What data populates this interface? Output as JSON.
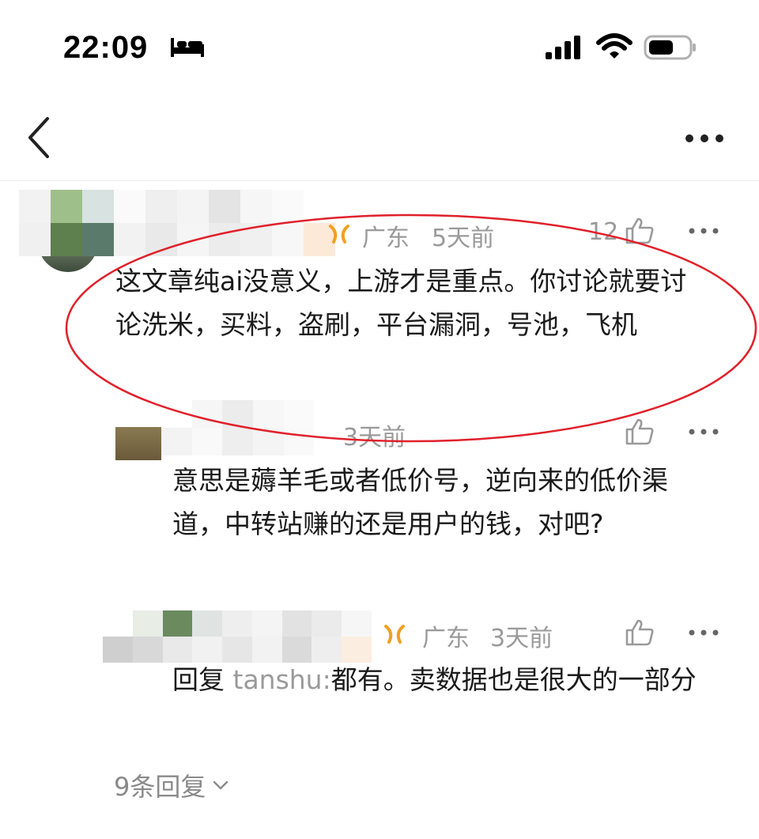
{
  "status_bar": {
    "time": "22:09"
  },
  "comments": {
    "main": {
      "location": "广东",
      "time_ago": "5天前",
      "likes": "12",
      "text": "这文章纯ai没意义，上游才是重点。你讨论就要讨论洗米，买料，盗刷，平台漏洞，号池，飞机"
    },
    "reply1": {
      "time_ago": "3天前",
      "text": "意思是薅羊毛或者低价号，逆向来的低价渠道，中转站赚的还是用户的钱，对吧?"
    },
    "reply2": {
      "location": "广东",
      "time_ago": "3天前",
      "reply_prefix": "回复",
      "reply_to": "tanshu",
      "reply_sep": ":",
      "text": "都有。卖数据也是很大的一部分"
    },
    "more_replies_label": "9条回复"
  },
  "colors": {
    "annotation_ellipse": "#e0202a",
    "meta_gray": "#9a9a9a",
    "badge_orange": "#f0a020"
  },
  "icons": [
    "bed-icon",
    "signal-icon",
    "wifi-icon",
    "battery-icon",
    "back-icon",
    "more-icon",
    "thumbs-up-icon",
    "badge-icon",
    "chevron-down-icon"
  ]
}
